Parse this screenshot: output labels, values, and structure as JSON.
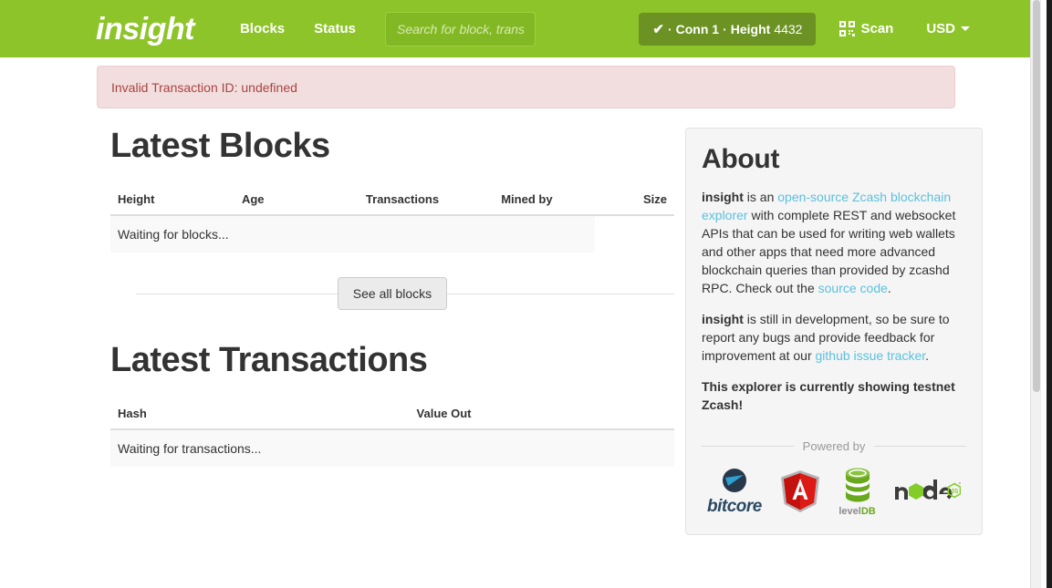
{
  "navbar": {
    "brand": "insight",
    "links": [
      {
        "label": "Blocks",
        "name": "nav-link-blocks"
      },
      {
        "label": "Status",
        "name": "nav-link-status"
      }
    ],
    "search_placeholder": "Search for block, transa",
    "search_value": "",
    "status": {
      "check": "✔",
      "sep1": "·",
      "conn_label": "Conn 1",
      "sep2": "·",
      "height_label": "Height",
      "height_value": "4432"
    },
    "scan_label": "Scan",
    "currency_label": "USD",
    "bg_color": "#8dc429",
    "badge_color": "#6b9223"
  },
  "alert": {
    "message": "Invalid Transaction ID: undefined",
    "bg_color": "#f2dede",
    "text_color": "#a94442"
  },
  "blocks": {
    "title": "Latest Blocks",
    "columns": [
      "Height",
      "Age",
      "Transactions",
      "Mined by",
      "Size"
    ],
    "empty_message": "Waiting for blocks...",
    "see_all_label": "See all blocks"
  },
  "transactions": {
    "title": "Latest Transactions",
    "columns": [
      "Hash",
      "Value Out"
    ],
    "empty_message": "Waiting for transactions..."
  },
  "about": {
    "title": "About",
    "p1": {
      "brand": "insight",
      "t1": " is an ",
      "link1": "open-source Zcash blockchain explorer",
      "t2": " with complete REST and websocket APIs that can be used for writing web wallets and other apps that need more advanced blockchain queries than provided by zcashd RPC. Check out the ",
      "link2": "source code",
      "t3": "."
    },
    "p2": {
      "brand": "insight",
      "t1": " is still in development, so be sure to report any bugs and provide feedback for improvement at our ",
      "link1": "github issue tracker",
      "t2": "."
    },
    "p3": "This explorer is currently showing testnet Zcash!",
    "powered_by": "Powered by",
    "link_color": "#5bc0de",
    "logos": [
      {
        "name": "bitcore-logo",
        "label": "bitcore"
      },
      {
        "name": "angularjs-logo",
        "label": "AngularJS"
      },
      {
        "name": "leveldb-logo",
        "label_gray": "level",
        "label_green": "DB"
      },
      {
        "name": "nodejs-logo",
        "label": "node"
      }
    ]
  }
}
